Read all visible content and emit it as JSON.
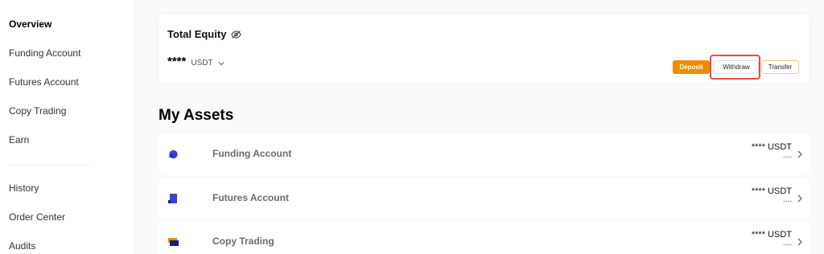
{
  "sidebar": {
    "items": [
      {
        "label": "Overview"
      },
      {
        "label": "Funding Account"
      },
      {
        "label": "Futures Account"
      },
      {
        "label": "Copy Trading"
      },
      {
        "label": "Earn"
      },
      {
        "label": "History"
      },
      {
        "label": "Order Center"
      },
      {
        "label": "Audits"
      }
    ]
  },
  "equity": {
    "title": "Total Equity",
    "value": "****",
    "unit": "USDT",
    "buttons": {
      "deposit": "Deposit",
      "withdraw": "Withdraw",
      "transfer": "Transfer"
    }
  },
  "assets": {
    "title": "My Assets",
    "rows": [
      {
        "name": "Funding Account",
        "amount": "**** USDT",
        "sub": "****"
      },
      {
        "name": "Futures Account",
        "amount": "**** USDT",
        "sub": "****"
      },
      {
        "name": "Copy Trading",
        "amount": "**** USDT",
        "sub": "****"
      }
    ]
  },
  "colors": {
    "accent": "#f28a04",
    "highlight": "#e84a4a"
  }
}
